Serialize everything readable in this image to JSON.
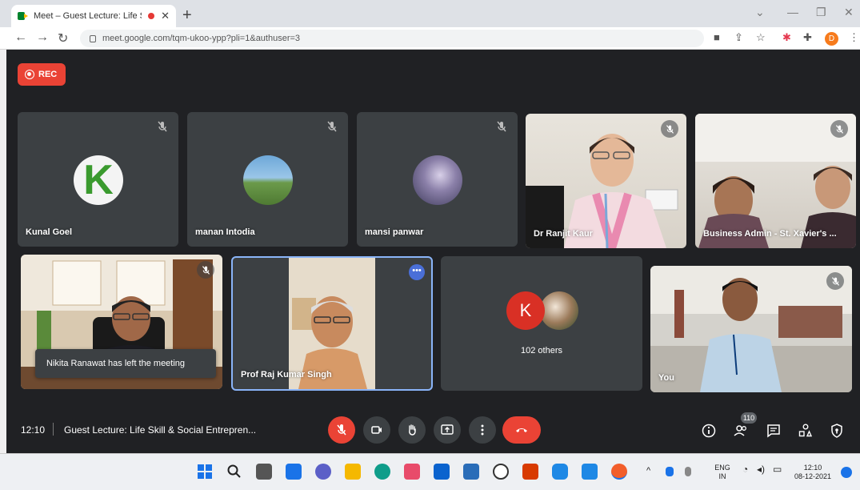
{
  "browser": {
    "tab_title": "Meet – Guest Lecture: Life S",
    "tab_close": "✕",
    "new_tab": "+",
    "url": "meet.google.com/tqm-ukoo-ypp?pli=1&authuser=3",
    "profile_initial": "D"
  },
  "meet": {
    "rec_label": "REC",
    "participants": [
      {
        "name": "Kunal Goel",
        "avatar_letter": "K"
      },
      {
        "name": "manan Intodia"
      },
      {
        "name": "mansi panwar"
      },
      {
        "name": "Dr Ranjit Kaur"
      },
      {
        "name": "Business Admin - St. Xavier's ..."
      },
      {
        "name": "Prof Raj Kumar Singh"
      },
      {
        "name": "You"
      }
    ],
    "others": {
      "avatar_letter": "K",
      "label": "102 others"
    },
    "toast": "Nikita Ranawat has left the meeting",
    "more_options": "•••"
  },
  "bottom_bar": {
    "time": "12:10",
    "meeting_title": "Guest Lecture: Life Skill & Social Entrepren...",
    "participant_count": "110"
  },
  "taskbar": {
    "lang": "ENG",
    "region": "IN",
    "time": "12:10",
    "date": "08-12-2021"
  },
  "colors": {
    "meet_bg": "#202124",
    "tile_bg": "#3c4043",
    "red": "#ea4335",
    "active_border": "#8ab4f8"
  }
}
